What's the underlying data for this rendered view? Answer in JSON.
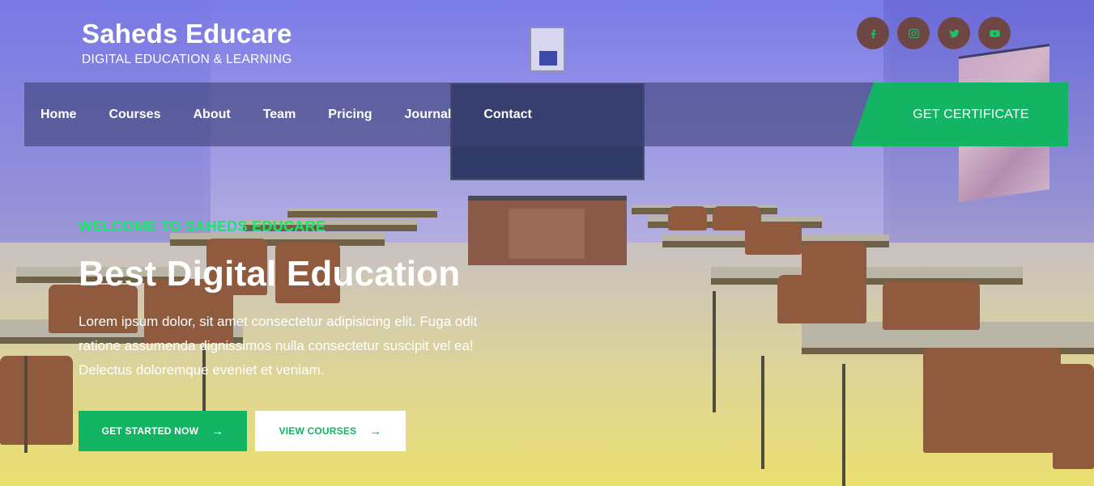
{
  "brand": {
    "name": "Saheds Educare",
    "tagline": "DIGITAL EDUCATION & LEARNING"
  },
  "socials": [
    {
      "icon": "facebook-icon",
      "glyph": "f"
    },
    {
      "icon": "instagram-icon",
      "glyph": ""
    },
    {
      "icon": "twitter-icon",
      "glyph": ""
    },
    {
      "icon": "youtube-icon",
      "glyph": ""
    }
  ],
  "nav": {
    "items": [
      "Home",
      "Courses",
      "About",
      "Team",
      "Pricing",
      "Journal",
      "Contact"
    ],
    "cta_label": "GET CERTIFICATE"
  },
  "hero": {
    "eyebrow": "WELCOME TO SAHEDS EDUCARE",
    "title": "Best Digital Education",
    "body": "Lorem ipsum dolor, sit amet consectetur adipisicing elit. Fuga odit ratione assumenda dignissimos nulla consectetur suscipit vel ea! Delectus doloremque eveniet et veniam.",
    "primary_button": "GET STARTED NOW",
    "secondary_button": "VIEW COURSES",
    "arrow": "→"
  },
  "colors": {
    "accent": "#13b464",
    "accent_text": "#18e86a",
    "social_bg": "#6e4643",
    "nav_bg": "rgba(62,66,120,0.62)"
  }
}
